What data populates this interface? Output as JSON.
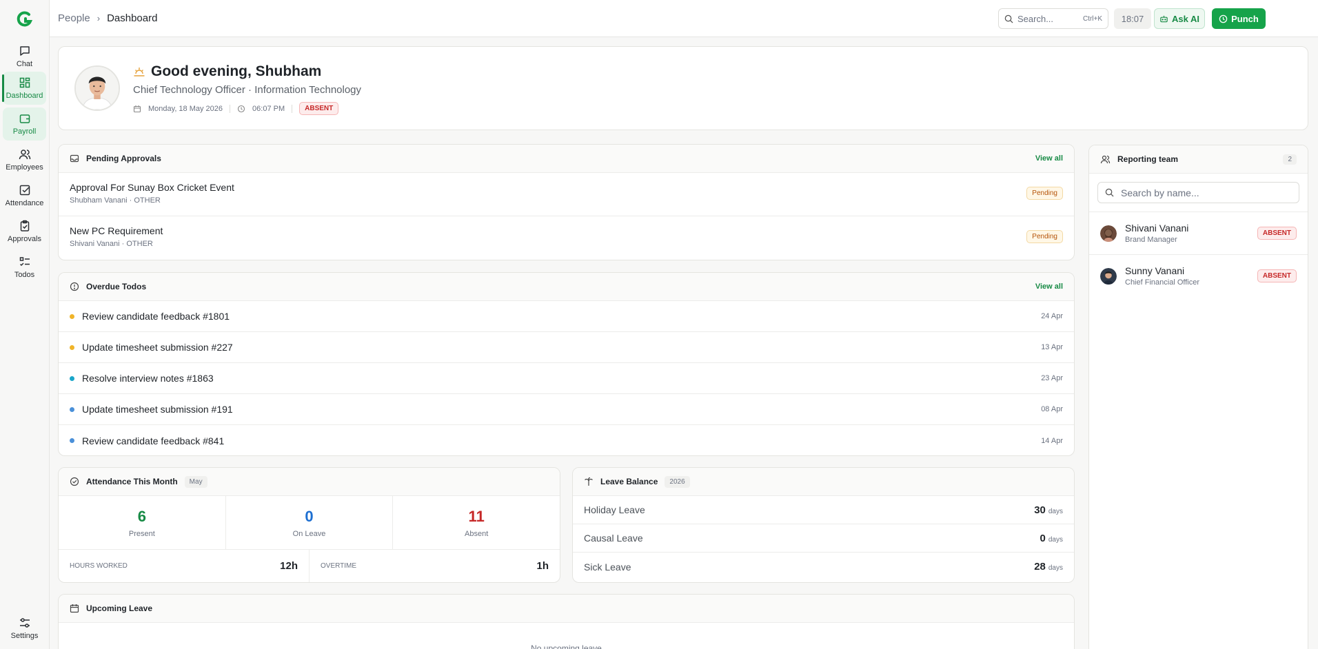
{
  "colors": {
    "brand": "#16a34a",
    "accent": "#178a45",
    "absent": "#c62828",
    "pending": "#b45309",
    "on_leave": "#1d6fd1"
  },
  "sidebar": {
    "items": [
      {
        "label": "Chat",
        "icon": "chat-icon"
      },
      {
        "label": "Dashboard",
        "icon": "dashboard-icon"
      },
      {
        "label": "Payroll",
        "icon": "wallet-icon"
      },
      {
        "label": "Employees",
        "icon": "users-icon"
      },
      {
        "label": "Attendance",
        "icon": "checkbox-icon"
      },
      {
        "label": "Approvals",
        "icon": "clipboard-check-icon"
      },
      {
        "label": "Todos",
        "icon": "list-checks-icon"
      }
    ],
    "settings_label": "Settings"
  },
  "header": {
    "breadcrumb": [
      "People",
      "Dashboard"
    ],
    "search_placeholder": "Search...",
    "search_shortcut": "Ctrl+K",
    "time": "18:07",
    "ask_ai_label": "Ask AI",
    "punch_label": "Punch"
  },
  "profile": {
    "greeting": "Good evening, Shubham",
    "role_line": "Chief Technology Officer · Information Technology",
    "date": "Monday, 18 May 2026",
    "time": "06:07 PM",
    "status": "ABSENT"
  },
  "pending_approvals": {
    "title": "Pending Approvals",
    "view_all": "View all",
    "items": [
      {
        "title": "Approval For Sunay Box Cricket Event",
        "subtitle": "Shubham Vanani · OTHER",
        "status": "Pending"
      },
      {
        "title": "New PC Requirement",
        "subtitle": "Shivani Vanani · OTHER",
        "status": "Pending"
      }
    ]
  },
  "overdue_todos": {
    "title": "Overdue Todos",
    "view_all": "View all",
    "items": [
      {
        "title": "Review candidate feedback #1801",
        "date": "24 Apr",
        "color": "#f0b429"
      },
      {
        "title": "Update timesheet submission #227",
        "date": "13 Apr",
        "color": "#f0b429"
      },
      {
        "title": "Resolve interview notes #1863",
        "date": "23 Apr",
        "color": "#1aa6c9"
      },
      {
        "title": "Update timesheet submission #191",
        "date": "08 Apr",
        "color": "#4a90d9"
      },
      {
        "title": "Review candidate feedback #841",
        "date": "14 Apr",
        "color": "#4a90d9"
      }
    ]
  },
  "attendance": {
    "title": "Attendance This Month",
    "month_tag": "May",
    "present": {
      "value": "6",
      "label": "Present"
    },
    "on_leave": {
      "value": "0",
      "label": "On Leave"
    },
    "absent": {
      "value": "11",
      "label": "Absent"
    },
    "hours_worked_label": "HOURS WORKED",
    "hours_worked": "12h",
    "overtime_label": "OVERTIME",
    "overtime": "1h"
  },
  "leave_balance": {
    "title": "Leave Balance",
    "year_tag": "2026",
    "unit": "days",
    "items": [
      {
        "label": "Holiday Leave",
        "value": "30"
      },
      {
        "label": "Causal Leave",
        "value": "0"
      },
      {
        "label": "Sick Leave",
        "value": "28"
      }
    ]
  },
  "upcoming_leave": {
    "title": "Upcoming Leave",
    "empty_text": "No upcoming leave"
  },
  "reporting_team": {
    "title": "Reporting team",
    "count": "2",
    "search_placeholder": "Search by name...",
    "members": [
      {
        "name": "Shivani Vanani",
        "role": "Brand Manager",
        "status": "ABSENT"
      },
      {
        "name": "Sunny Vanani",
        "role": "Chief Financial Officer",
        "status": "ABSENT"
      }
    ]
  }
}
